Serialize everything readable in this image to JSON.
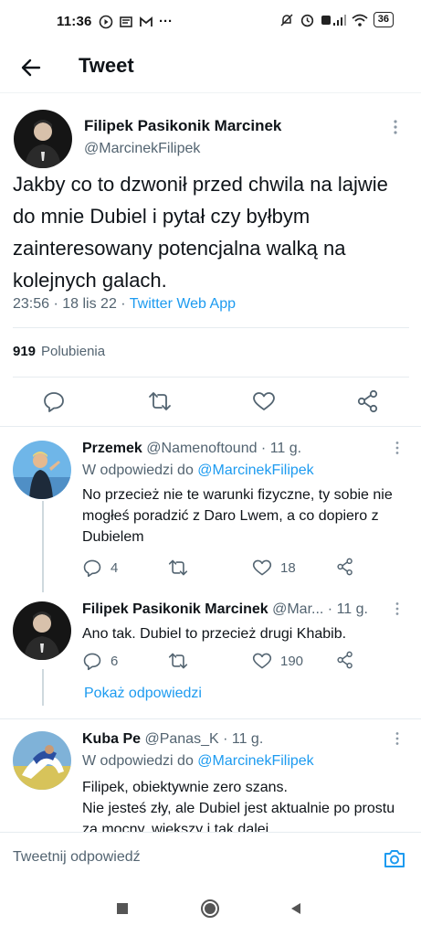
{
  "status_bar": {
    "time": "11:36",
    "battery": "36"
  },
  "header": {
    "title": "Tweet"
  },
  "tweet": {
    "author_name": "Filipek Pasikonik Marcinek",
    "author_handle": "@MarcinekFilipek",
    "text": "Jakby co to dzwonił przed chwila na lajwie do mnie Dubiel i pytał czy byłbym zainteresowany potencjalna walką na kolejnych galach.",
    "timestamp": "23:56 · 18 lis 22 · ",
    "source": "Twitter Web App",
    "likes_count": "919",
    "likes_label": "Polubienia"
  },
  "replies": [
    {
      "name": "Przemek",
      "handle": "@Namenoftound · 11 g.",
      "reply_to_prefix": "W odpowiedzi do ",
      "reply_to": "@MarcinekFilipek",
      "text": "No przecież nie te warunki fizyczne, ty sobie nie mogłeś poradzić z Daro Lwem, a co dopiero z Dubielem",
      "reply_count": "4",
      "like_count": "18"
    },
    {
      "name": "Filipek Pasikonik Marcinek",
      "handle": "@Mar... · 11 g.",
      "text": "Ano tak. Dubiel to przecież drugi Khabib.",
      "reply_count": "6",
      "like_count": "190"
    },
    {
      "name": "Kuba Pe",
      "handle": "@Panas_K · 11 g.",
      "reply_to_prefix": "W odpowiedzi do ",
      "reply_to": "@MarcinekFilipek",
      "text": "Filipek, obiektywnie zero szans.\nNie jesteś zły, ale Dubiel jest aktualnie po prostu za mocny, większy i tak dalej"
    }
  ],
  "show_replies_label": "Pokaż odpowiedzi",
  "composer": {
    "placeholder": "Tweetnij odpowiedź"
  },
  "colors": {
    "accent": "#1d9bf0",
    "secondary_text": "#536471"
  },
  "icons": [
    "back-arrow-icon",
    "more-vert-icon",
    "reply-icon",
    "retweet-icon",
    "like-icon",
    "share-icon",
    "camera-icon"
  ]
}
